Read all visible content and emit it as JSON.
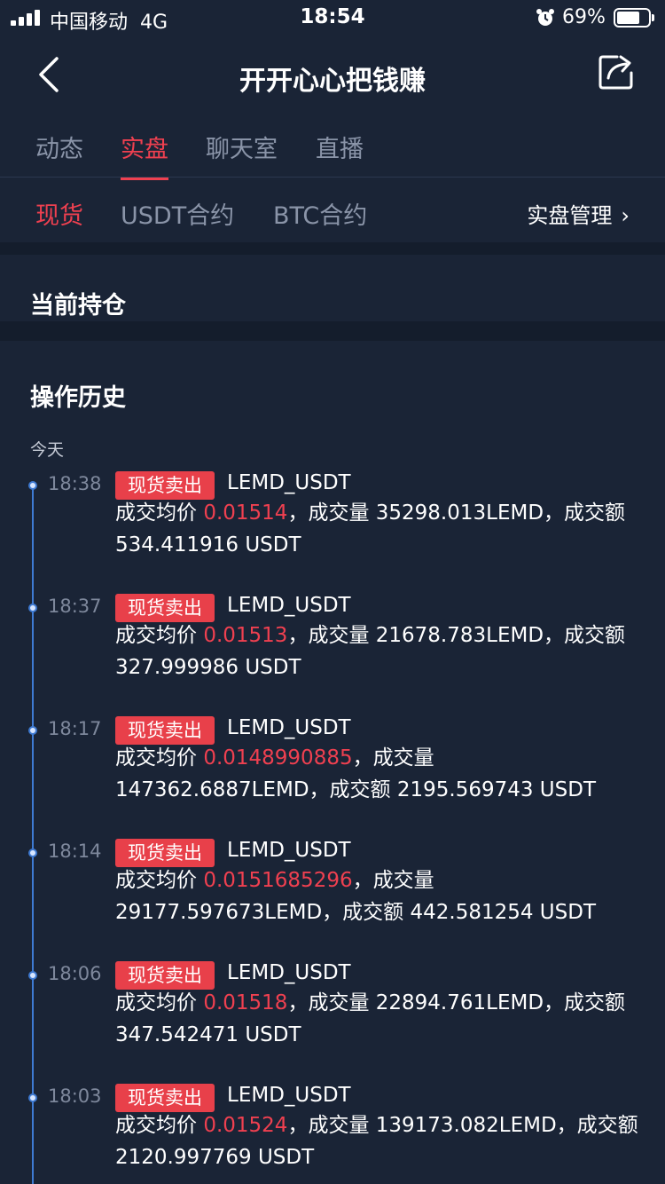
{
  "status_bar": {
    "carrier": "中国移动",
    "network": "4G",
    "time": "18:54",
    "battery_percent": "69%",
    "battery_level": 0.69,
    "icons": [
      "signal-icon",
      "alarm-icon",
      "battery-icon"
    ]
  },
  "nav": {
    "title": "开开心心把钱赚",
    "icons": [
      "back-icon",
      "share-icon"
    ]
  },
  "top_tabs": [
    {
      "label": "动态",
      "active": false
    },
    {
      "label": "实盘",
      "active": true
    },
    {
      "label": "聊天室",
      "active": false
    },
    {
      "label": "直播",
      "active": false
    }
  ],
  "sub_tabs": [
    {
      "label": "现货",
      "active": true
    },
    {
      "label": "USDT合约",
      "active": false
    },
    {
      "label": "BTC合约",
      "active": false
    }
  ],
  "manage_link": {
    "label": "实盘管理",
    "icon": "chevron-right-icon"
  },
  "holdings": {
    "title": "当前持仓"
  },
  "history": {
    "title": "操作历史",
    "group_label": "今天",
    "entries": [
      {
        "time": "18:38",
        "badge": "现货卖出",
        "pair": "LEMD_USDT",
        "price_label": "成交均价",
        "price": "0.01514",
        "rest": "，成交量 35298.013LEMD，成交额 534.411916 USDT"
      },
      {
        "time": "18:37",
        "badge": "现货卖出",
        "pair": "LEMD_USDT",
        "price_label": "成交均价",
        "price": "0.01513",
        "rest": "，成交量 21678.783LEMD，成交额 327.999986 USDT"
      },
      {
        "time": "18:17",
        "badge": "现货卖出",
        "pair": "LEMD_USDT",
        "price_label": "成交均价",
        "price": "0.0148990885",
        "rest": "，成交量 147362.6887LEMD，成交额 2195.569743 USDT"
      },
      {
        "time": "18:14",
        "badge": "现货卖出",
        "pair": "LEMD_USDT",
        "price_label": "成交均价",
        "price": "0.0151685296",
        "rest": "，成交量 29177.597673LEMD，成交额 442.581254 USDT"
      },
      {
        "time": "18:06",
        "badge": "现货卖出",
        "pair": "LEMD_USDT",
        "price_label": "成交均价",
        "price": "0.01518",
        "rest": "，成交量 22894.761LEMD，成交额 347.542471 USDT"
      },
      {
        "time": "18:03",
        "badge": "现货卖出",
        "pair": "LEMD_USDT",
        "price_label": "成交均价",
        "price": "0.01524",
        "rest": "，成交量 139173.082LEMD，成交额 2120.997769 USDT"
      }
    ]
  },
  "colors": {
    "background": "#1a2436",
    "accent_red": "#ef4050",
    "badge_red": "#e8404a",
    "timeline_blue": "#3e7ad2",
    "muted_text": "#8a94a8"
  }
}
